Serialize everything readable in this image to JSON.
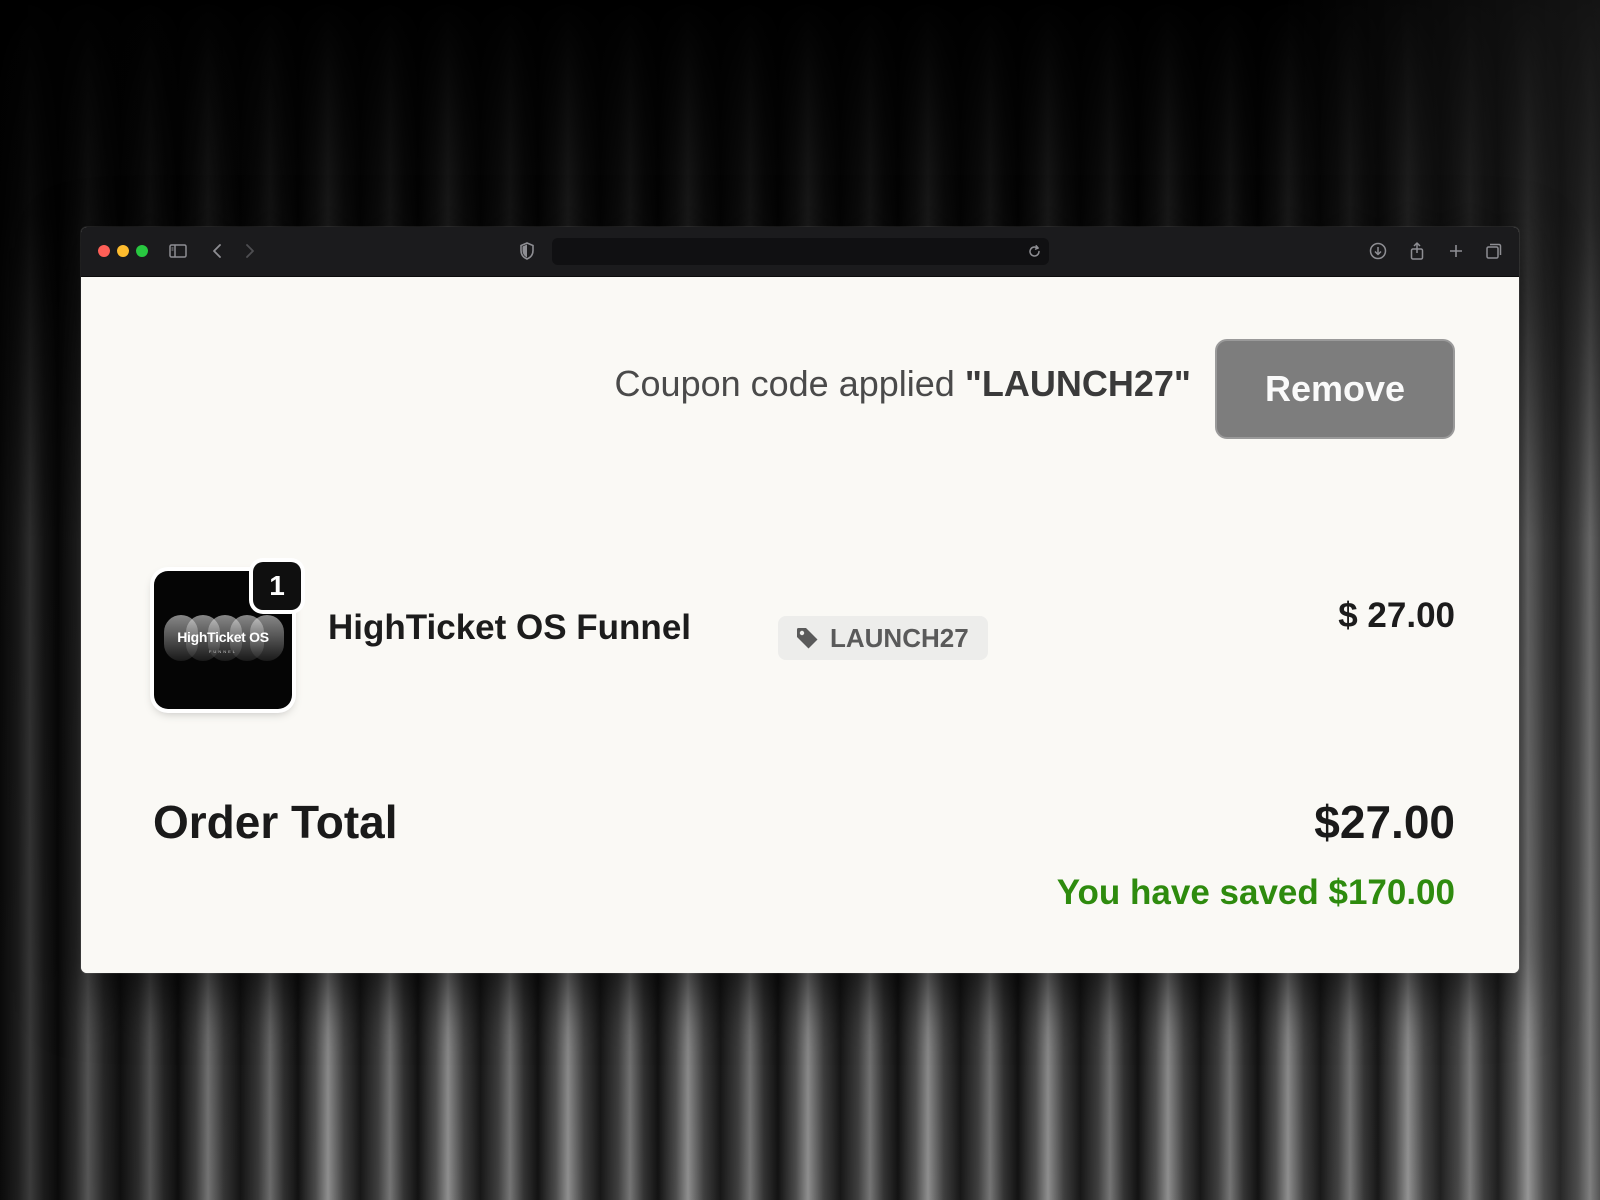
{
  "window": {
    "controls": [
      "close",
      "minimize",
      "zoom"
    ],
    "toolbar_icons": [
      "sidebar-icon",
      "back-icon",
      "forward-icon",
      "shield-icon",
      "reload-icon",
      "download-icon",
      "share-icon",
      "new-tab-icon",
      "tabs-overview-icon"
    ],
    "url": ""
  },
  "coupon": {
    "applied_text": "Coupon code applied",
    "code_display": "\"LAUNCH27\"",
    "remove_label": "Remove"
  },
  "cart": {
    "items": [
      {
        "name": "HighTicket OS Funnel",
        "quantity": "1",
        "coupon_tag": "LAUNCH27",
        "price": "$ 27.00",
        "thumbnail_text": "HighTicket OS",
        "thumbnail_subtext": "FUNNEL"
      }
    ]
  },
  "summary": {
    "total_label": "Order Total",
    "total_value": "$27.00",
    "savings_text": "You have saved $170.00"
  },
  "colors": {
    "savings_green": "#2e8b0e",
    "remove_button": "#7d7d7d",
    "page_background": "#faf9f5",
    "toolbar": "#1b1b1d"
  }
}
